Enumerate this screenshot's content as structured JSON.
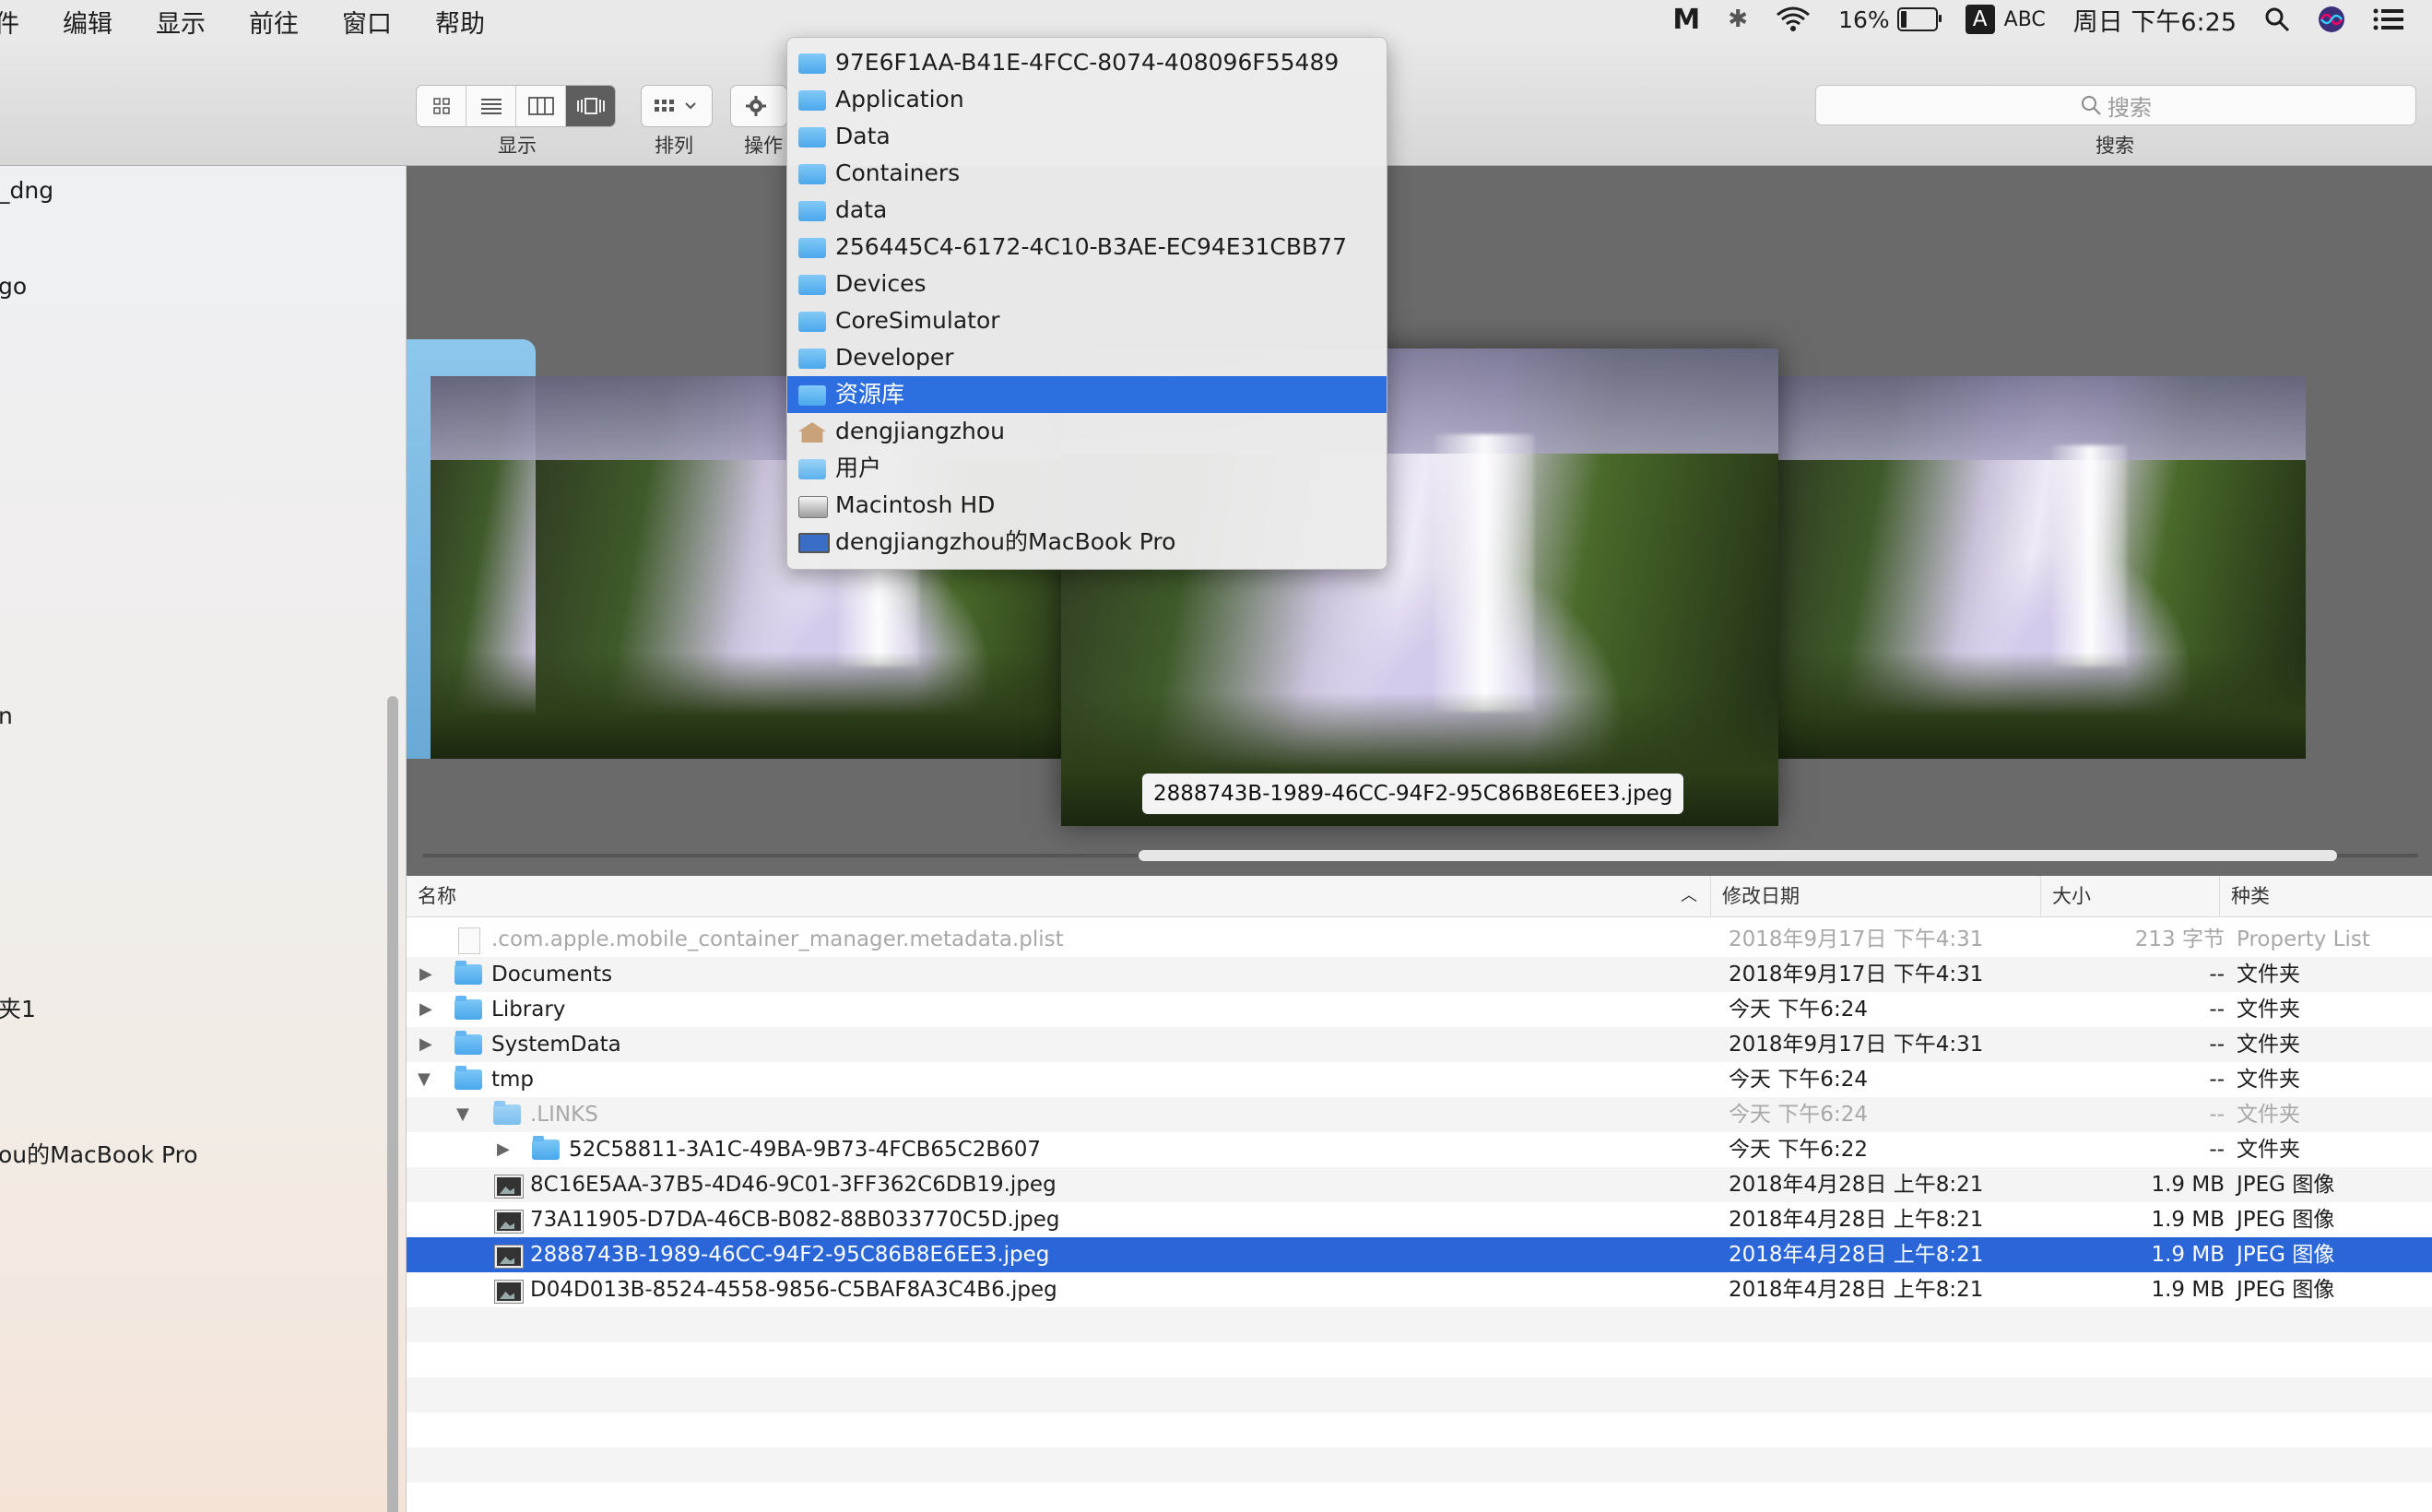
{
  "menubar": {
    "items": [
      "件",
      "编辑",
      "显示",
      "前往",
      "窗口",
      "帮助"
    ],
    "battery": "16%",
    "input_badge": "A",
    "input_method": "ABC",
    "clock": "周日 下午6:25",
    "icons": [
      "malwarebytes-icon",
      "bluetooth-icon",
      "wifi-icon",
      "battery-icon",
      "spotlight-icon",
      "siri-icon",
      "notification-center-icon"
    ]
  },
  "toolbar": {
    "view_label": "显示",
    "arrange_label": "排列",
    "action_label": "操作",
    "search_placeholder": "搜索",
    "search_label": "搜索"
  },
  "sidebar": {
    "items": [
      "_dng",
      "go",
      "n",
      "夹1",
      "ou的MacBook Pro"
    ]
  },
  "path_menu": {
    "items": [
      {
        "label": "97E6F1AA-B41E-4FCC-8074-408096F55489",
        "icon": "folder-icon"
      },
      {
        "label": "Application",
        "icon": "folder-icon"
      },
      {
        "label": "Data",
        "icon": "folder-icon"
      },
      {
        "label": "Containers",
        "icon": "folder-icon"
      },
      {
        "label": "data",
        "icon": "folder-icon"
      },
      {
        "label": "256445C4-6172-4C10-B3AE-EC94E31CBB77",
        "icon": "folder-icon"
      },
      {
        "label": "Devices",
        "icon": "folder-icon"
      },
      {
        "label": "CoreSimulator",
        "icon": "folder-icon"
      },
      {
        "label": "Developer",
        "icon": "folder-icon"
      },
      {
        "label": "资源库",
        "icon": "library-folder-icon",
        "selected": true
      },
      {
        "label": "dengjiangzhou",
        "icon": "home-icon"
      },
      {
        "label": "用户",
        "icon": "users-folder-icon"
      },
      {
        "label": "Macintosh HD",
        "icon": "hard-drive-icon"
      },
      {
        "label": "dengjiangzhou的MacBook Pro",
        "icon": "computer-icon"
      }
    ]
  },
  "coverflow": {
    "selected_caption": "2888743B-1989-46CC-94F2-95C86B8E6EE3.jpeg"
  },
  "list": {
    "columns": {
      "name": "名称",
      "date": "修改日期",
      "size": "大小",
      "kind": "种类"
    },
    "rows": [
      {
        "name": ".com.apple.mobile_container_manager.metadata.plist",
        "date": "2018年9月17日 下午4:31",
        "size": "213 字节",
        "kind": "Property List"
      },
      {
        "name": "Documents",
        "date": "2018年9月17日 下午4:31",
        "size": "--",
        "kind": "文件夹"
      },
      {
        "name": "Library",
        "date": "今天 下午6:24",
        "size": "--",
        "kind": "文件夹"
      },
      {
        "name": "SystemData",
        "date": "2018年9月17日 下午4:31",
        "size": "--",
        "kind": "文件夹"
      },
      {
        "name": "tmp",
        "date": "今天 下午6:24",
        "size": "--",
        "kind": "文件夹"
      },
      {
        "name": ".LINKS",
        "date": "今天 下午6:24",
        "size": "--",
        "kind": "文件夹"
      },
      {
        "name": "52C58811-3A1C-49BA-9B73-4FCB65C2B607",
        "date": "今天 下午6:22",
        "size": "--",
        "kind": "文件夹"
      },
      {
        "name": "8C16E5AA-37B5-4D46-9C01-3FF362C6DB19.jpeg",
        "date": "2018年4月28日 上午8:21",
        "size": "1.9 MB",
        "kind": "JPEG 图像"
      },
      {
        "name": "73A11905-D7DA-46CB-B082-88B033770C5D.jpeg",
        "date": "2018年4月28日 上午8:21",
        "size": "1.9 MB",
        "kind": "JPEG 图像"
      },
      {
        "name": "2888743B-1989-46CC-94F2-95C86B8E6EE3.jpeg",
        "date": "2018年4月28日 上午8:21",
        "size": "1.9 MB",
        "kind": "JPEG 图像",
        "selected": true
      },
      {
        "name": "D04D013B-8524-4558-9856-C5BAF8A3C4B6.jpeg",
        "date": "2018年4月28日 上午8:21",
        "size": "1.9 MB",
        "kind": "JPEG 图像"
      }
    ]
  }
}
